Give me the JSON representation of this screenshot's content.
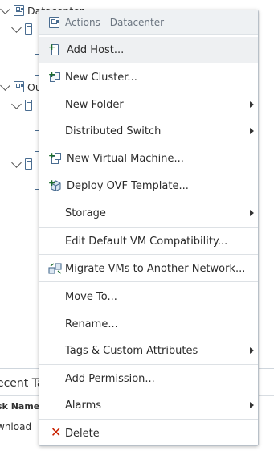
{
  "tree": {
    "items": [
      {
        "label": "Datacenter",
        "level": 0,
        "type": "datacenter",
        "expanded": true
      },
      {
        "label": "",
        "level": 1,
        "type": "host",
        "expanded": true
      },
      {
        "label": "",
        "level": 2,
        "type": "child"
      },
      {
        "label": "",
        "level": 2,
        "type": "child"
      },
      {
        "label": "Ou",
        "level": 0,
        "type": "datacenter",
        "expanded": true
      },
      {
        "label": "",
        "level": 1,
        "type": "host",
        "expanded": true
      },
      {
        "label": "",
        "level": 2,
        "type": "child"
      },
      {
        "label": "",
        "level": 2,
        "type": "child"
      },
      {
        "label": "",
        "level": 1,
        "type": "host",
        "expanded": true
      },
      {
        "label": "",
        "level": 2,
        "type": "child"
      }
    ]
  },
  "bottom_panel": {
    "title": "ecent Ta",
    "column_header": "sk Name",
    "cell": "wnload"
  },
  "menu": {
    "header_title": "Actions - Datacenter",
    "items": [
      {
        "id": "add-host",
        "label": "Add Host...",
        "icon": "add-host-icon",
        "submenu": false
      },
      {
        "id": "new-cluster",
        "label": "New Cluster...",
        "icon": "new-cluster-icon",
        "submenu": false
      },
      {
        "id": "new-folder",
        "label": "New Folder",
        "icon": "",
        "submenu": true
      },
      {
        "id": "distributed-switch",
        "label": "Distributed Switch",
        "icon": "",
        "submenu": true
      },
      {
        "id": "new-vm",
        "label": "New Virtual Machine...",
        "icon": "new-vm-icon",
        "submenu": false
      },
      {
        "id": "deploy-ovf",
        "label": "Deploy OVF Template...",
        "icon": "deploy-ovf-icon",
        "submenu": false
      },
      {
        "id": "storage",
        "label": "Storage",
        "icon": "",
        "submenu": true
      },
      {
        "id": "edit-vm-compat",
        "label": "Edit Default VM Compatibility...",
        "icon": "",
        "submenu": false
      },
      {
        "id": "migrate-vms",
        "label": "Migrate VMs to Another Network...",
        "icon": "migrate-network-icon",
        "submenu": false
      },
      {
        "id": "move-to",
        "label": "Move To...",
        "icon": "",
        "submenu": false
      },
      {
        "id": "rename",
        "label": "Rename...",
        "icon": "",
        "submenu": false
      },
      {
        "id": "tags",
        "label": "Tags & Custom Attributes",
        "icon": "",
        "submenu": true
      },
      {
        "id": "add-permission",
        "label": "Add Permission...",
        "icon": "",
        "submenu": false
      },
      {
        "id": "alarms",
        "label": "Alarms",
        "icon": "",
        "submenu": true
      },
      {
        "id": "delete",
        "label": "Delete",
        "icon": "delete-icon",
        "submenu": false
      }
    ]
  },
  "colors": {
    "menu_header_bg": "#eef1f3",
    "hover_bg": "#eef0f2",
    "icon_blue": "#4a6d91",
    "plus_green": "#1c6b2e",
    "delete_red": "#c92100",
    "separator": "#dde1e5"
  }
}
